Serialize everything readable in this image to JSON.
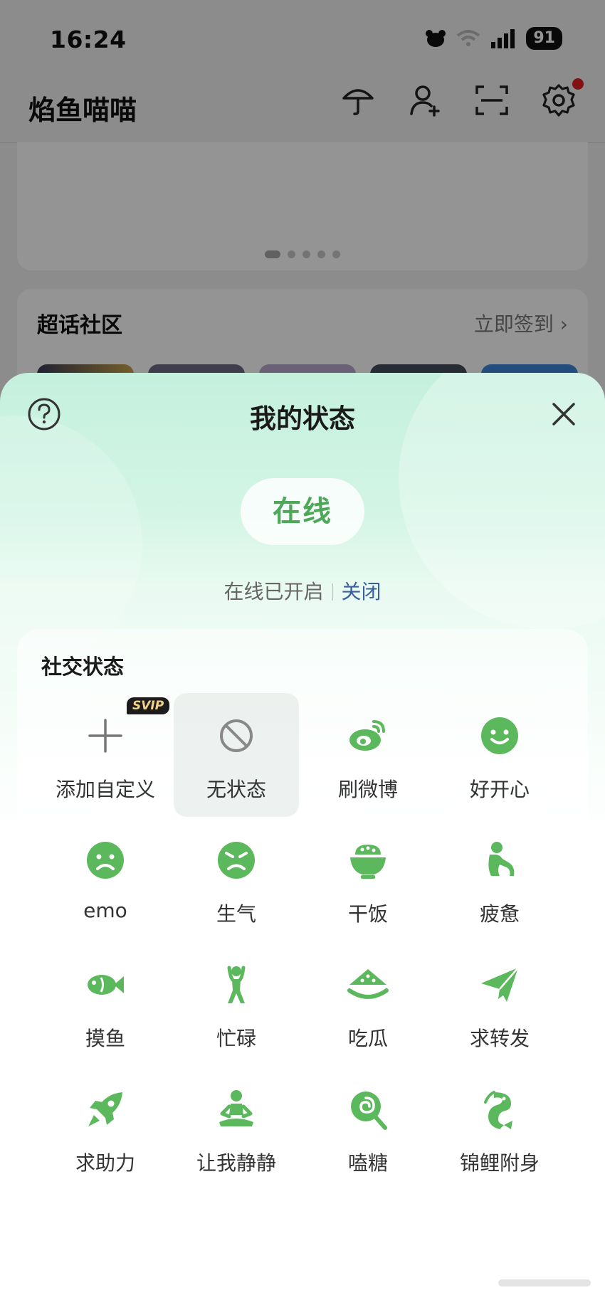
{
  "status_bar": {
    "time": "16:24",
    "battery": "91"
  },
  "header": {
    "title": "焰鱼喵喵"
  },
  "supertopic": {
    "title": "超话社区",
    "action": "立即签到"
  },
  "sheet": {
    "title": "我的状态",
    "current_status": "在线",
    "status_note": "在线已开启",
    "close_label": "关闭"
  },
  "social": {
    "title": "社交状态",
    "svip_badge": "SVIP",
    "items": [
      {
        "label": "添加自定义",
        "icon": "plus-icon"
      },
      {
        "label": "无状态",
        "icon": "no-status-icon"
      },
      {
        "label": "刷微博",
        "icon": "weibo-icon"
      },
      {
        "label": "好开心",
        "icon": "happy-face-icon"
      },
      {
        "label": "emo",
        "icon": "sad-face-icon"
      },
      {
        "label": "生气",
        "icon": "angry-face-icon"
      },
      {
        "label": "干饭",
        "icon": "rice-bowl-icon"
      },
      {
        "label": "疲惫",
        "icon": "tired-person-icon"
      },
      {
        "label": "摸鱼",
        "icon": "fish-icon"
      },
      {
        "label": "忙碌",
        "icon": "busy-person-icon"
      },
      {
        "label": "吃瓜",
        "icon": "watermelon-icon"
      },
      {
        "label": "求转发",
        "icon": "paper-plane-icon"
      },
      {
        "label": "求助力",
        "icon": "rocket-icon"
      },
      {
        "label": "让我静静",
        "icon": "meditate-icon"
      },
      {
        "label": "嗑糖",
        "icon": "lollipop-icon"
      },
      {
        "label": "锦鲤附身",
        "icon": "koi-icon"
      }
    ]
  },
  "colors": {
    "accent_green": "#5cb85c",
    "link_blue": "#3a5f9e"
  }
}
